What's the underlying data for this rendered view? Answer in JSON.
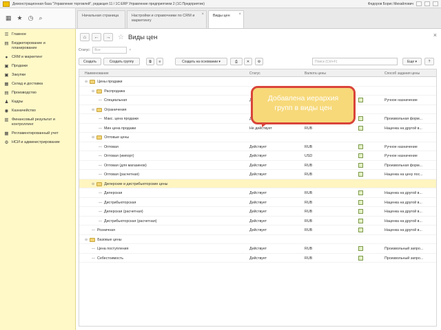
{
  "window": {
    "title": "Демонстрационная база \"Управление торговлей\", редакция 11 / 1С:ERP Управление предприятием 2 (1С:Предприятие)",
    "user": "Федоров Борис Михайлович"
  },
  "tabs": [
    {
      "label": "Начальная страница"
    },
    {
      "label": "Настройки и справочники по CRM и маркетингу"
    },
    {
      "label": "Виды цен"
    }
  ],
  "sidebar": {
    "items": [
      {
        "label": "Главное",
        "icon": "menu-icon"
      },
      {
        "label": "Бюджетирование и планирование",
        "icon": "budget-icon"
      },
      {
        "label": "CRM и маркетинг",
        "icon": "crm-icon"
      },
      {
        "label": "Продажи",
        "icon": "sales-icon"
      },
      {
        "label": "Закупки",
        "icon": "purchases-icon"
      },
      {
        "label": "Склад и доставка",
        "icon": "warehouse-icon"
      },
      {
        "label": "Производство",
        "icon": "production-icon"
      },
      {
        "label": "Кадры",
        "icon": "staff-icon"
      },
      {
        "label": "Казначейство",
        "icon": "treasury-icon"
      },
      {
        "label": "Финансовый результат и контроллинг",
        "icon": "finance-icon"
      },
      {
        "label": "Регламентированный учет",
        "icon": "accounting-icon"
      },
      {
        "label": "НСИ и администрирование",
        "icon": "admin-icon"
      }
    ]
  },
  "main": {
    "title": "Виды цен",
    "filter": {
      "label": "Статус:",
      "placeholder": "Все"
    },
    "buttons": {
      "create": "Создать",
      "create_group": "Создать группу",
      "create_based_on": "Создать на основании",
      "search_placeholder": "Поиск (Ctrl+F)",
      "more": "Еще",
      "help": "?"
    },
    "columns": {
      "name": "Наименование",
      "status": "Статус",
      "currency": "Валюта цены",
      "method": "Способ задания цены"
    },
    "rows": [
      {
        "level": 0,
        "type": "group",
        "expand": "⊖",
        "name": "Цены продажи",
        "status": "",
        "currency": "",
        "method": ""
      },
      {
        "level": 1,
        "type": "group",
        "expand": "⊖",
        "name": "Распродажа",
        "status": "",
        "currency": "",
        "method": ""
      },
      {
        "level": 2,
        "type": "item",
        "name": "Специальная",
        "status": "Действует",
        "currency": "RUB",
        "method": "Ручное назначение"
      },
      {
        "level": 1,
        "type": "group",
        "expand": "⊖",
        "name": "Ограничения",
        "status": "",
        "currency": "",
        "method": ""
      },
      {
        "level": 2,
        "type": "item",
        "name": "Макс. цена продажи",
        "status": "Действует",
        "currency": "RUB",
        "method": "Произвольная форм..."
      },
      {
        "level": 2,
        "type": "item",
        "name": "Мин цена продажи",
        "status": "Не действует",
        "currency": "RUB",
        "method": "Наценка на другой в..."
      },
      {
        "level": 1,
        "type": "group",
        "expand": "⊖",
        "name": "Оптовые цены",
        "status": "",
        "currency": "",
        "method": ""
      },
      {
        "level": 2,
        "type": "item",
        "name": "Оптовая",
        "status": "Действует",
        "currency": "RUB",
        "method": "Ручное назначение"
      },
      {
        "level": 2,
        "type": "item",
        "name": "Оптовая (импорт)",
        "status": "Действует",
        "currency": "USD",
        "method": "Ручное назначение"
      },
      {
        "level": 2,
        "type": "item",
        "name": "Оптовая (для магазинов)",
        "status": "Действует",
        "currency": "RUB",
        "method": "Произвольная форм..."
      },
      {
        "level": 2,
        "type": "item",
        "name": "Оптовая (расчетная)",
        "status": "Действует",
        "currency": "RUB",
        "method": "Наценка на цену пос..."
      },
      {
        "level": 1,
        "type": "group",
        "expand": "⊖",
        "name": "Дилерские и дистрибьюторские цены",
        "status": "",
        "currency": "",
        "method": "",
        "highlight": true
      },
      {
        "level": 2,
        "type": "item",
        "name": "Дилерская",
        "status": "Действует",
        "currency": "RUB",
        "method": "Наценка на другой в..."
      },
      {
        "level": 2,
        "type": "item",
        "name": "Дистрибьюторская",
        "status": "Действует",
        "currency": "RUB",
        "method": "Наценка на другой в..."
      },
      {
        "level": 2,
        "type": "item",
        "name": "Дилерская (расчетная)",
        "status": "Действует",
        "currency": "RUB",
        "method": "Наценка на другой в..."
      },
      {
        "level": 2,
        "type": "item",
        "name": "Дистрибьюторская (расчетная)",
        "status": "Действует",
        "currency": "RUB",
        "method": "Наценка на другой в..."
      },
      {
        "level": 1,
        "type": "item",
        "name": "Розничная",
        "status": "Действует",
        "currency": "RUB",
        "method": "Наценка на другой в..."
      },
      {
        "level": 0,
        "type": "group",
        "expand": "⊖",
        "name": "Базовые цены",
        "status": "",
        "currency": "",
        "method": ""
      },
      {
        "level": 1,
        "type": "item",
        "name": "Цена поступления",
        "status": "Действует",
        "currency": "RUB",
        "method": "Произвольный запро..."
      },
      {
        "level": 1,
        "type": "item",
        "name": "Себестоимость",
        "status": "Действует",
        "currency": "RUB",
        "method": "Произвольный запро..."
      }
    ]
  },
  "callout": {
    "line1": "Добавлена иерархия",
    "line2": "групп в виды цен"
  },
  "colors": {
    "sidebar_bg": "#fff9c8",
    "highlight_row": "#fff5c0",
    "callout_fill": "#f7d97a",
    "callout_border": "#d9443a"
  }
}
